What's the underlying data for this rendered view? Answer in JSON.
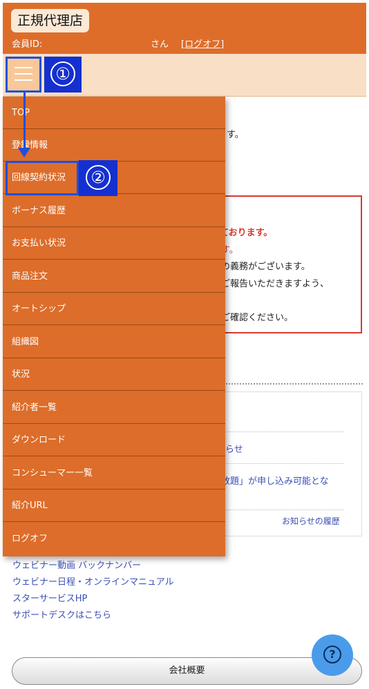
{
  "header": {
    "brand": "正規代理店",
    "member_id_label": "会員ID:",
    "san": "さん",
    "logoff_link": "[ログオフ]"
  },
  "annotations": {
    "step1": "①",
    "step2": "②"
  },
  "menu": {
    "items": [
      {
        "label": "TOP"
      },
      {
        "label": "登録情報"
      },
      {
        "label": "回線契約状況"
      },
      {
        "label": "ボーナス履歴"
      },
      {
        "label": "お支払い状況"
      },
      {
        "label": "商品注文"
      },
      {
        "label": "オートシップ"
      },
      {
        "label": "組織図"
      },
      {
        "label": "状況"
      },
      {
        "label": "紹介者一覧"
      },
      {
        "label": "ダウンロード"
      },
      {
        "label": "コンシューマー一覧"
      },
      {
        "label": "紹介URL"
      },
      {
        "label": "ログオフ"
      }
    ]
  },
  "main": {
    "line1": "す。",
    "notice": {
      "line1": "ております。",
      "line2": "す。",
      "line3": "の義務がございます。",
      "line4": "ご報告いただきますよう、",
      "line5": "ご確認ください。"
    },
    "news": {
      "item1": "らせ",
      "item2": "放題」が申し込み可能とな",
      "history_link": "お知らせの履歴"
    }
  },
  "bottom_links": [
    "ウェビナー動画 バックナンバー",
    "ウェビナー日程・オンラインマニュアル",
    "スターサービスHP",
    "サポートデスクはこちら"
  ],
  "help_icon": "?",
  "company_button": "会社概要",
  "colors": {
    "header": "#de6d2a",
    "menu": "#dd6d2a",
    "annotation": "#1530d0",
    "notice_border": "#d63a2e"
  }
}
